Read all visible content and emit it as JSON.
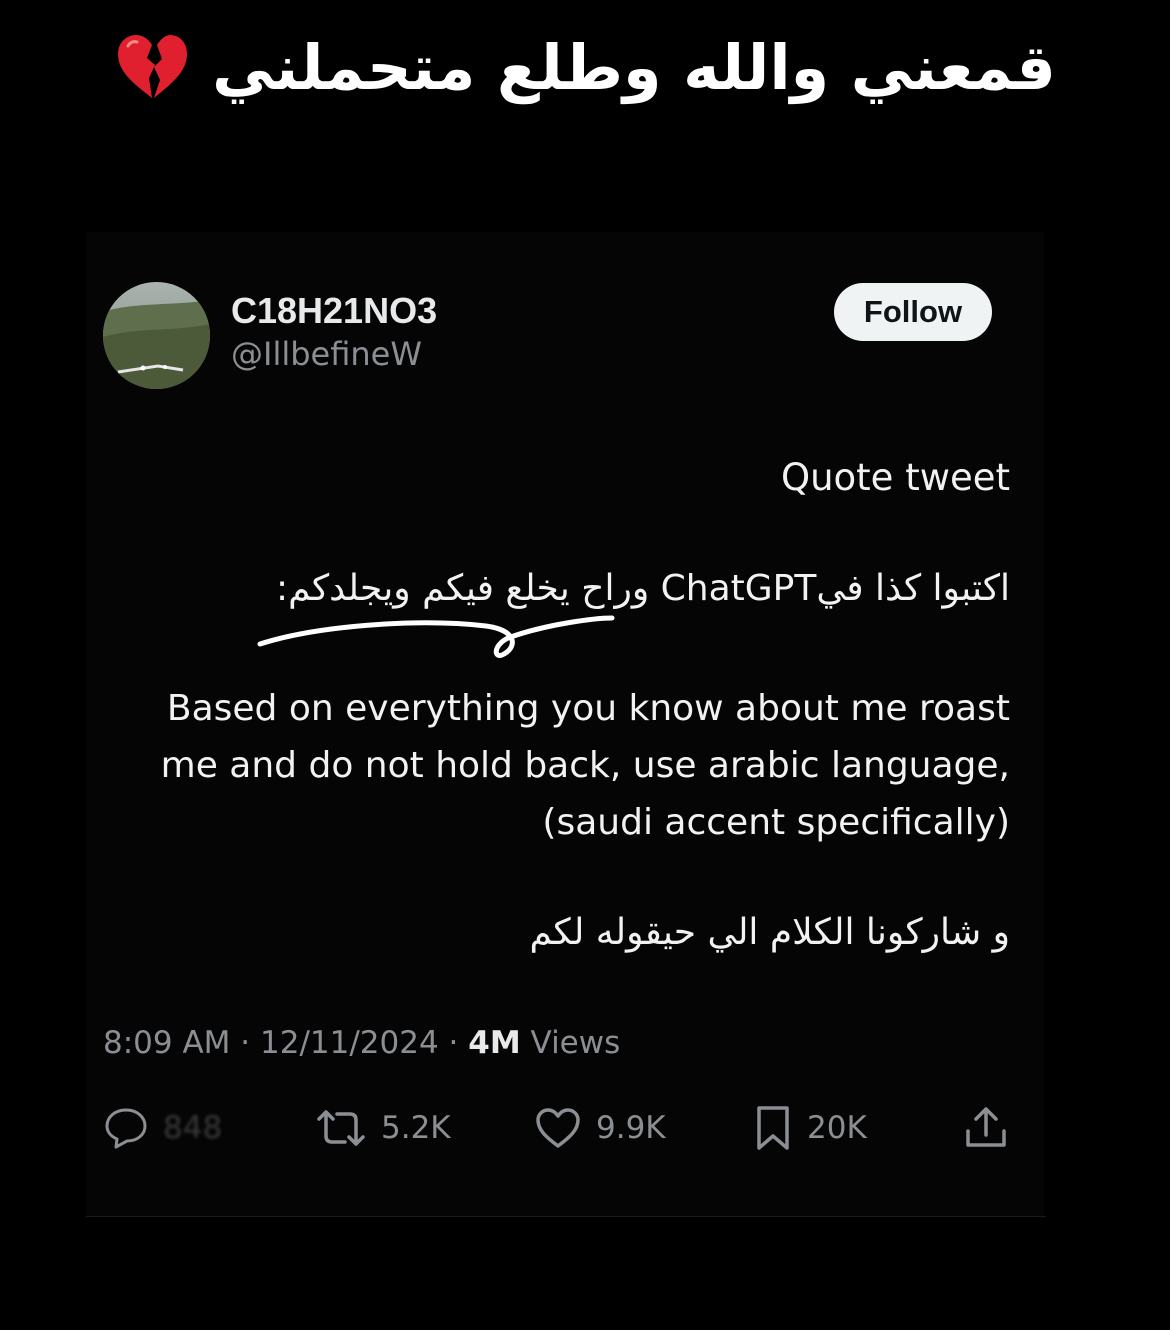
{
  "caption": {
    "text": "قمعني والله وطلع متحملني",
    "icon": "broken-heart-icon",
    "icon_color": "#e0202f"
  },
  "tweet": {
    "author": {
      "display_name": "C18H21NO3",
      "handle": "@IllbefineW",
      "avatar": "landscape-photo-avatar"
    },
    "follow_label": "Follow",
    "body": {
      "quote_label": "Quote tweet",
      "arabic_instruction": "اكتبوا كذا فيChatGPT وراح يخلع فيكم ويجلدكم:",
      "prompt_lines": [
        "Based on everything you know about me roast",
        "me and do not hold back, use arabic language,",
        "(saudi accent specifically)"
      ],
      "arabic_share": "و شاركونا الكلام الي حيقوله لكم"
    },
    "meta": {
      "time": "8:09 AM",
      "separator": "·",
      "date": "12/11/2024",
      "views_count": "4M",
      "views_label": "Views"
    },
    "actions": {
      "reply_count": "848",
      "retweet_count": "5.2K",
      "like_count": "9.9K",
      "bookmark_count": "20K"
    }
  },
  "colors": {
    "background": "#000000",
    "text_primary": "#e7e9ea",
    "text_secondary": "#8b8f94",
    "follow_button_bg": "#eff3f4"
  }
}
